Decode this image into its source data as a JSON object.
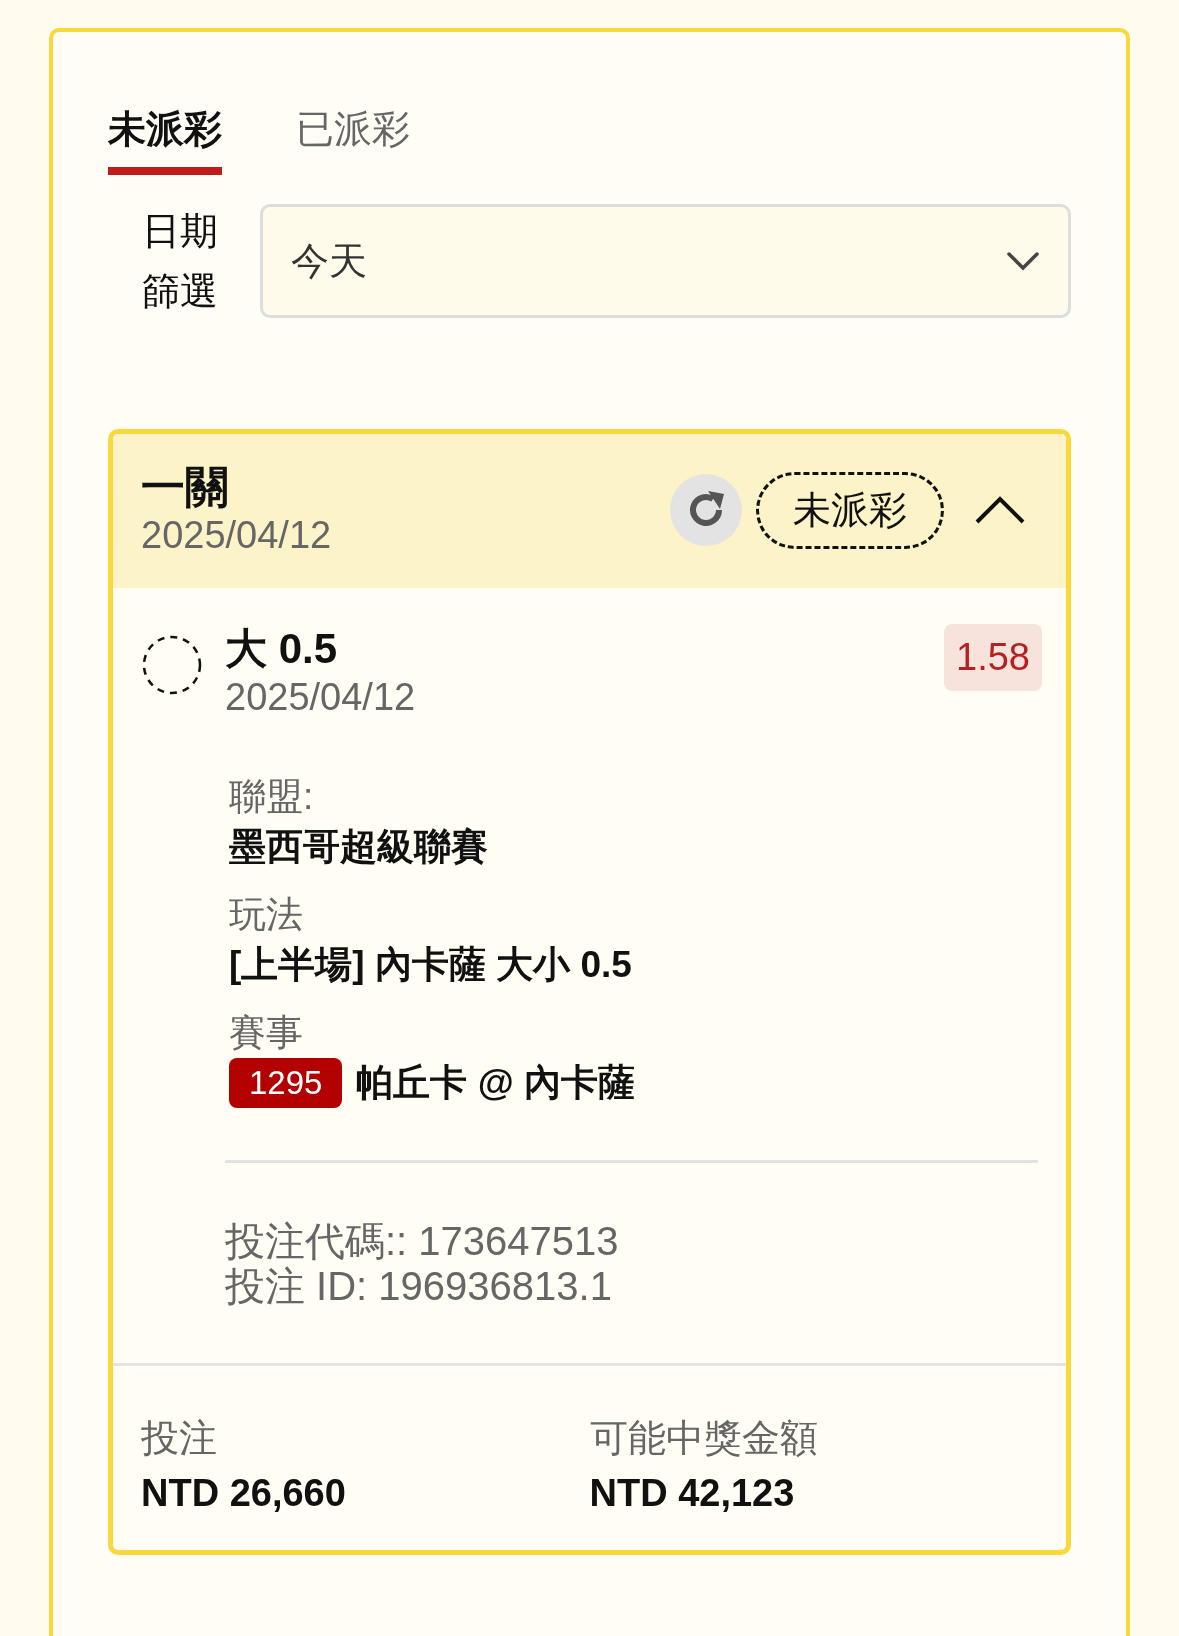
{
  "tabs": [
    {
      "label": "未派彩",
      "selected": true
    },
    {
      "label": "已派彩",
      "selected": false
    }
  ],
  "date_filter": {
    "label": "日期篩選",
    "value": "今天"
  },
  "bets": [
    {
      "title": "一關",
      "date": "2025/04/12",
      "status": "未派彩",
      "expanded": true,
      "selections": [
        {
          "title": "大 0.5",
          "date": "2025/04/12",
          "odds": "1.58",
          "fields": [
            {
              "kind": "text",
              "label": "聯盟:",
              "value": "墨西哥超級聯賽"
            },
            {
              "kind": "text",
              "label": "玩法",
              "value": "[上半場] 內卡薩 大小 0.5"
            },
            {
              "kind": "event",
              "label": "賽事",
              "number": "1295",
              "value": "帕丘卡 @ 內卡薩"
            }
          ]
        }
      ],
      "codes": [
        "投注代碼:: 173647513",
        "投注 ID: 196936813.1"
      ],
      "summary": [
        {
          "label": "投注",
          "value": "NTD 26,660"
        },
        {
          "label": "可能中獎金額",
          "value": "NTD 42,123"
        }
      ]
    }
  ]
}
